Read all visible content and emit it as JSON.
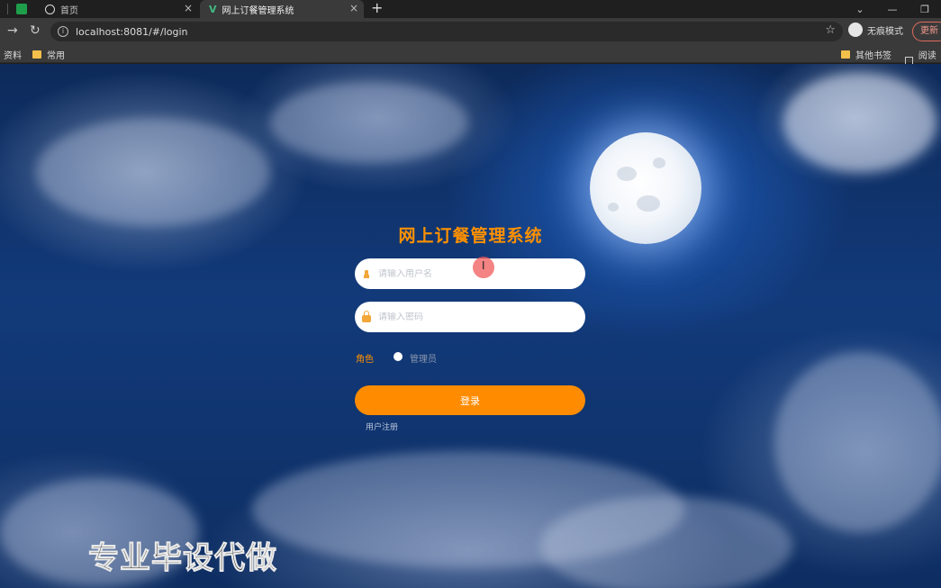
{
  "browser": {
    "tabs": [
      {
        "label": "首页"
      },
      {
        "label": "网上订餐管理系统"
      }
    ],
    "new_tab": "+",
    "url": "localhost:8081/#/login",
    "incognito_label": "无痕模式",
    "update_label": "更新",
    "bookmarks": {
      "left_partial": "资料",
      "common": "常用",
      "other": "其他书签",
      "reading": "阅读清"
    }
  },
  "login": {
    "title": "网上订餐管理系统",
    "username_placeholder": "请输入用户名",
    "password_placeholder": "请输入密码",
    "role_label": "角色",
    "role_option": "管理员",
    "login_button": "登录",
    "register_link": "用户注册"
  },
  "watermark": "专业毕设代做",
  "colors": {
    "accent": "#ff8c00",
    "title": "#ff9100",
    "chrome_dark": "#1f1f1f",
    "chrome_mid": "#3a3a3a"
  }
}
